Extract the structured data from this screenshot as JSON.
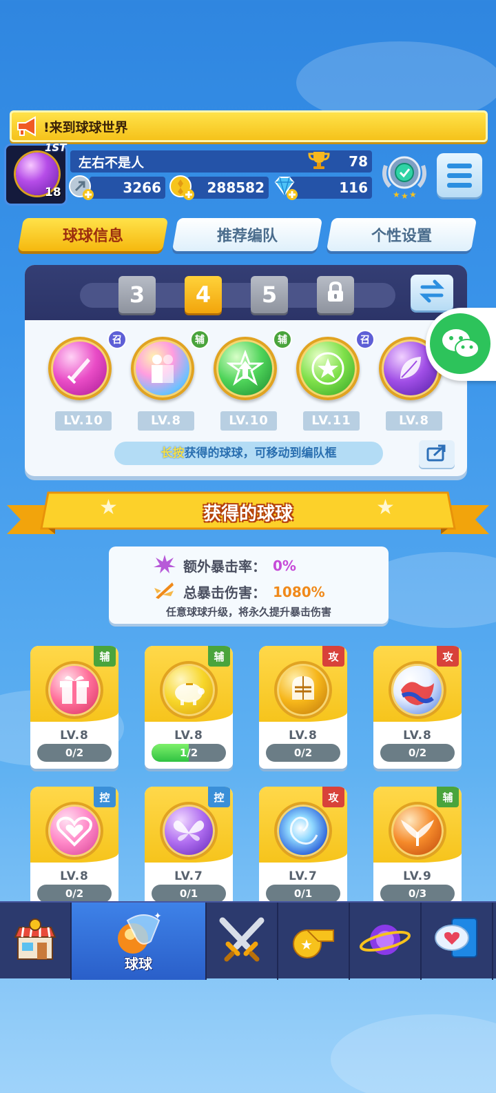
{
  "notice": {
    "text": "!来到球球世界"
  },
  "profile": {
    "rank_label": "1ST",
    "level": "18",
    "name": "左右不是人",
    "trophies": "78",
    "energy": "3266",
    "coins": "288582",
    "gems": "116"
  },
  "tabs": [
    {
      "label": "球球信息",
      "active": true
    },
    {
      "label": "推荐编队",
      "active": false
    },
    {
      "label": "个性设置",
      "active": false
    }
  ],
  "team": {
    "slots": [
      "3",
      "4",
      "5"
    ],
    "active_slot": "4",
    "balls": [
      {
        "tag": "召",
        "level": "LV.10"
      },
      {
        "tag": "辅",
        "level": "LV.8"
      },
      {
        "tag": "辅",
        "level": "LV.10"
      },
      {
        "tag": "召",
        "level": "LV.11"
      },
      {
        "tag": "",
        "level": "LV.8"
      }
    ],
    "hint_highlight": "长按",
    "hint_rest": "获得的球球，可移动到编队框"
  },
  "section_title": "获得的球球",
  "crit": {
    "extra_rate_label": "额外暴击率：",
    "extra_rate_value": "0%",
    "total_damage_label": "总暴击伤害：",
    "total_damage_value": "1080%",
    "note": "任意球球升级，将永久提升暴击伤害"
  },
  "cards": [
    {
      "tag": "辅",
      "level": "LV.8",
      "progress": "0/2",
      "fraction": 0
    },
    {
      "tag": "辅",
      "level": "LV.8",
      "progress": "1/2",
      "fraction": 0.5
    },
    {
      "tag": "攻",
      "level": "LV.8",
      "progress": "0/2",
      "fraction": 0
    },
    {
      "tag": "攻",
      "level": "LV.8",
      "progress": "0/2",
      "fraction": 0
    },
    {
      "tag": "控",
      "level": "LV.8",
      "progress": "0/2",
      "fraction": 0
    },
    {
      "tag": "控",
      "level": "LV.7",
      "progress": "0/1",
      "fraction": 0
    },
    {
      "tag": "攻",
      "level": "LV.7",
      "progress": "0/1",
      "fraction": 0
    },
    {
      "tag": "辅",
      "level": "LV.9",
      "progress": "0/3",
      "fraction": 0
    }
  ],
  "nav": {
    "active_label": "球球",
    "items": [
      "shop-icon",
      "ball-icon",
      "swords-icon",
      "whistle-icon",
      "planet-icon",
      "chat-heart-icon"
    ]
  }
}
